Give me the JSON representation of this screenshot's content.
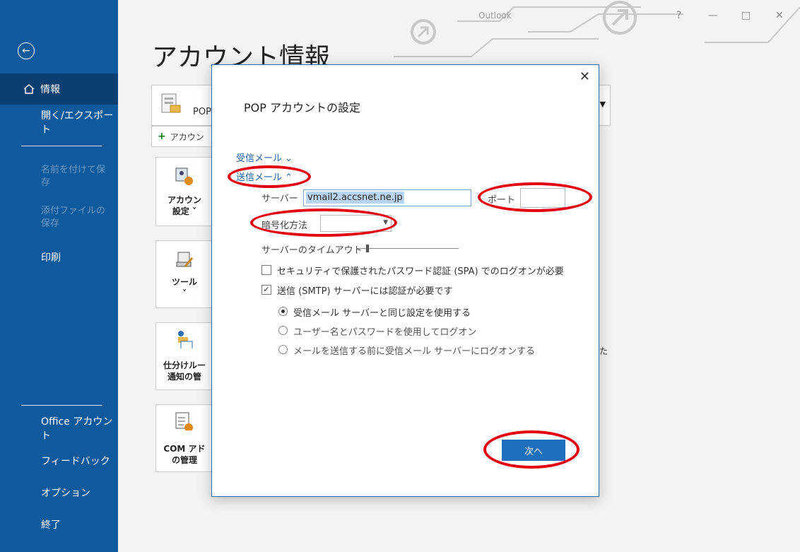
{
  "sidebar": {
    "items": [
      {
        "label": "情報"
      },
      {
        "label": "開く/エクスポート"
      },
      {
        "label": "名前を付けて保存"
      },
      {
        "label": "添付ファイルの保存"
      },
      {
        "label": "印刷"
      },
      {
        "label": "Office アカウント"
      },
      {
        "label": "フィードバック"
      },
      {
        "label": "オプション"
      },
      {
        "label": "終了"
      }
    ]
  },
  "main": {
    "title": "アカウント情報",
    "window_title": "Outlook",
    "account_type": "POP",
    "add_account": "アカウン",
    "cards": [
      {
        "label": "アカウン\n設定 ˅"
      },
      {
        "label": "ツール\n˅"
      },
      {
        "label": "仕分けルー\n通知の管"
      },
      {
        "label": "COM アド\nの管理"
      }
    ],
    "bg_text": "た"
  },
  "dialog": {
    "title": "POP アカウントの設定",
    "incoming_link": "受信メール ⌄",
    "outgoing_link": "送信メール ⌃",
    "server_label": "サーバー",
    "server_value": "vmail2.accsnet.ne.jp",
    "port_label": "ポート",
    "port_value": "",
    "encryption_label": "暗号化方法",
    "encryption_value": "",
    "timeout_label": "サーバーのタイムアウト",
    "timeout_level": 0.1,
    "spa_label": "セキュリティで保護されたパスワード認証 (SPA) でのログオンが必要",
    "spa_checked": false,
    "smtp_auth_label": "送信 (SMTP) サーバーには認証が必要です",
    "smtp_auth_checked": true,
    "radio_options": [
      {
        "label": "受信メール サーバーと同じ設定を使用する",
        "selected": true
      },
      {
        "label": "ユーザー名とパスワードを使用してログオン",
        "selected": false
      },
      {
        "label": "メールを送信する前に受信メール サーバーにログオンする",
        "selected": false
      }
    ],
    "next_button": "次へ"
  },
  "colors": {
    "sidebar_bg": "#0f5a9c",
    "sidebar_active": "#0b3f70",
    "accent": "#1f6fbf",
    "annotation_red": "#e3000f"
  }
}
